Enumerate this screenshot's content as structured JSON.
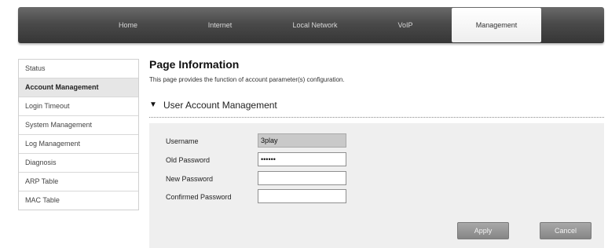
{
  "nav": {
    "items": [
      {
        "label": "Home"
      },
      {
        "label": "Internet"
      },
      {
        "label": "Local Network"
      },
      {
        "label": "VoIP"
      },
      {
        "label": "Management"
      }
    ],
    "active": "Management"
  },
  "sidebar": {
    "items": [
      {
        "label": "Status"
      },
      {
        "label": "Account Management"
      },
      {
        "label": "Login Timeout"
      },
      {
        "label": "System Management"
      },
      {
        "label": "Log Management"
      },
      {
        "label": "Diagnosis"
      },
      {
        "label": "ARP Table"
      },
      {
        "label": "MAC Table"
      }
    ],
    "active": "Account Management"
  },
  "page": {
    "title": "Page Information",
    "description": "This page provides the function of account parameter(s) configuration."
  },
  "section": {
    "arrow": "▼",
    "title": "User Account Management"
  },
  "form": {
    "username": {
      "label": "Username",
      "value": "3play"
    },
    "old_password": {
      "label": "Old Password",
      "value": "••••••"
    },
    "new_password": {
      "label": "New Password",
      "value": ""
    },
    "confirmed_password": {
      "label": "Confirmed Password",
      "value": ""
    }
  },
  "buttons": {
    "apply": "Apply",
    "cancel": "Cancel"
  }
}
